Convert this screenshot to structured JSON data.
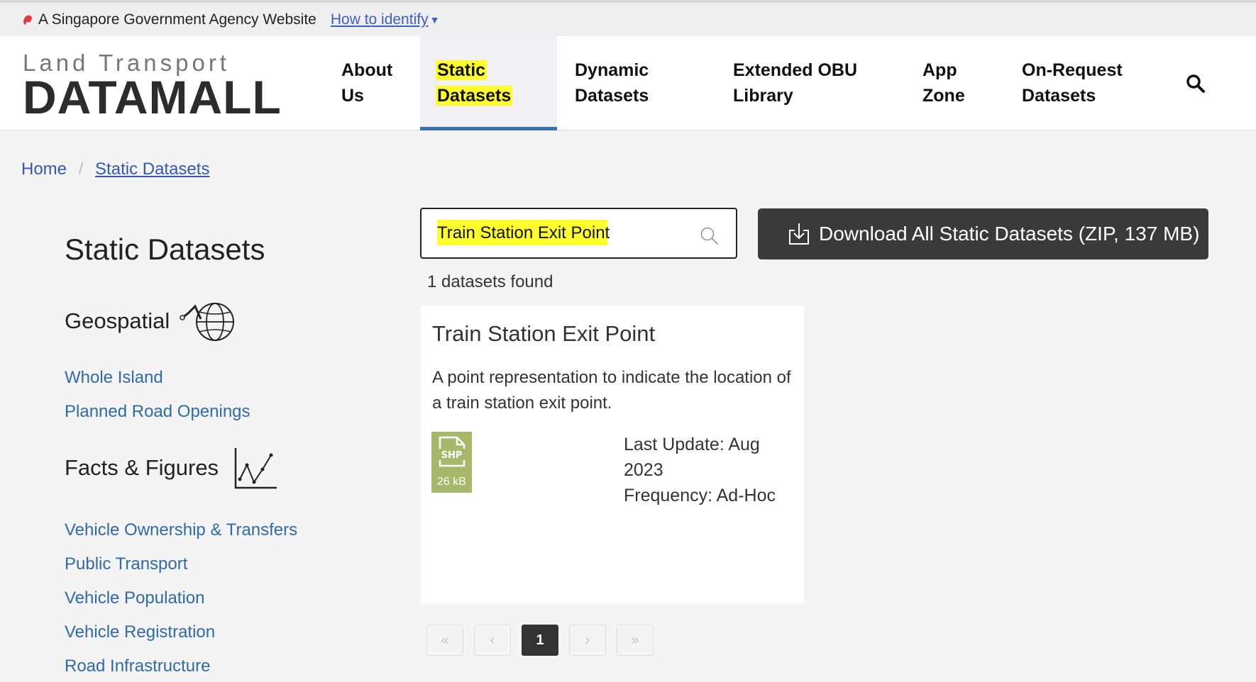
{
  "govbar": {
    "agency_text": "A Singapore Government Agency Website",
    "how_to_identify": "How to identify"
  },
  "logo": {
    "line1": "Land Transport",
    "line2": "DATAMALL"
  },
  "nav": {
    "items": [
      {
        "line1": "About",
        "line2": "Us"
      },
      {
        "line1": "Static",
        "line2": "Datasets"
      },
      {
        "line1": "Dynamic",
        "line2": "Datasets"
      },
      {
        "line1": "Extended OBU",
        "line2": "Library"
      },
      {
        "line1": "App",
        "line2": "Zone"
      },
      {
        "line1": "On-Request",
        "line2": "Datasets"
      }
    ],
    "active_index": 1
  },
  "breadcrumb": {
    "home": "Home",
    "separator": "/",
    "current": "Static Datasets"
  },
  "sidebar": {
    "title": "Static Datasets",
    "sections": [
      {
        "name": "Geospatial",
        "icon": "globe-icon",
        "links": [
          "Whole Island",
          "Planned Road Openings"
        ]
      },
      {
        "name": "Facts & Figures",
        "icon": "line-chart-icon",
        "links": [
          "Vehicle Ownership & Transfers",
          "Public Transport",
          "Vehicle Population",
          "Vehicle Registration",
          "Road Infrastructure"
        ]
      }
    ]
  },
  "search": {
    "value": "Train Station Exit Point",
    "icon": "search-icon"
  },
  "download": {
    "label": "Download All Static Datasets (ZIP, 137 MB)",
    "icon": "download-icon"
  },
  "results": {
    "count_text": "1 datasets found",
    "items": [
      {
        "title": "Train Station Exit Point",
        "description": "A point representation to indicate the location of a train station exit point.",
        "file_type": "SHP",
        "file_size": "26 kB",
        "last_update": "Last Update: Aug 2023",
        "frequency": "Frequency: Ad-Hoc"
      }
    ]
  },
  "pagination": {
    "first": "«",
    "prev": "‹",
    "current": "1",
    "next": "›",
    "last": "»"
  },
  "colors": {
    "highlight": "#ffff2e",
    "link_blue": "#2f6aaa",
    "dark_button": "#3a3a3a",
    "active_underline": "#3a6fb0",
    "shp_badge": "#a8b86a"
  }
}
